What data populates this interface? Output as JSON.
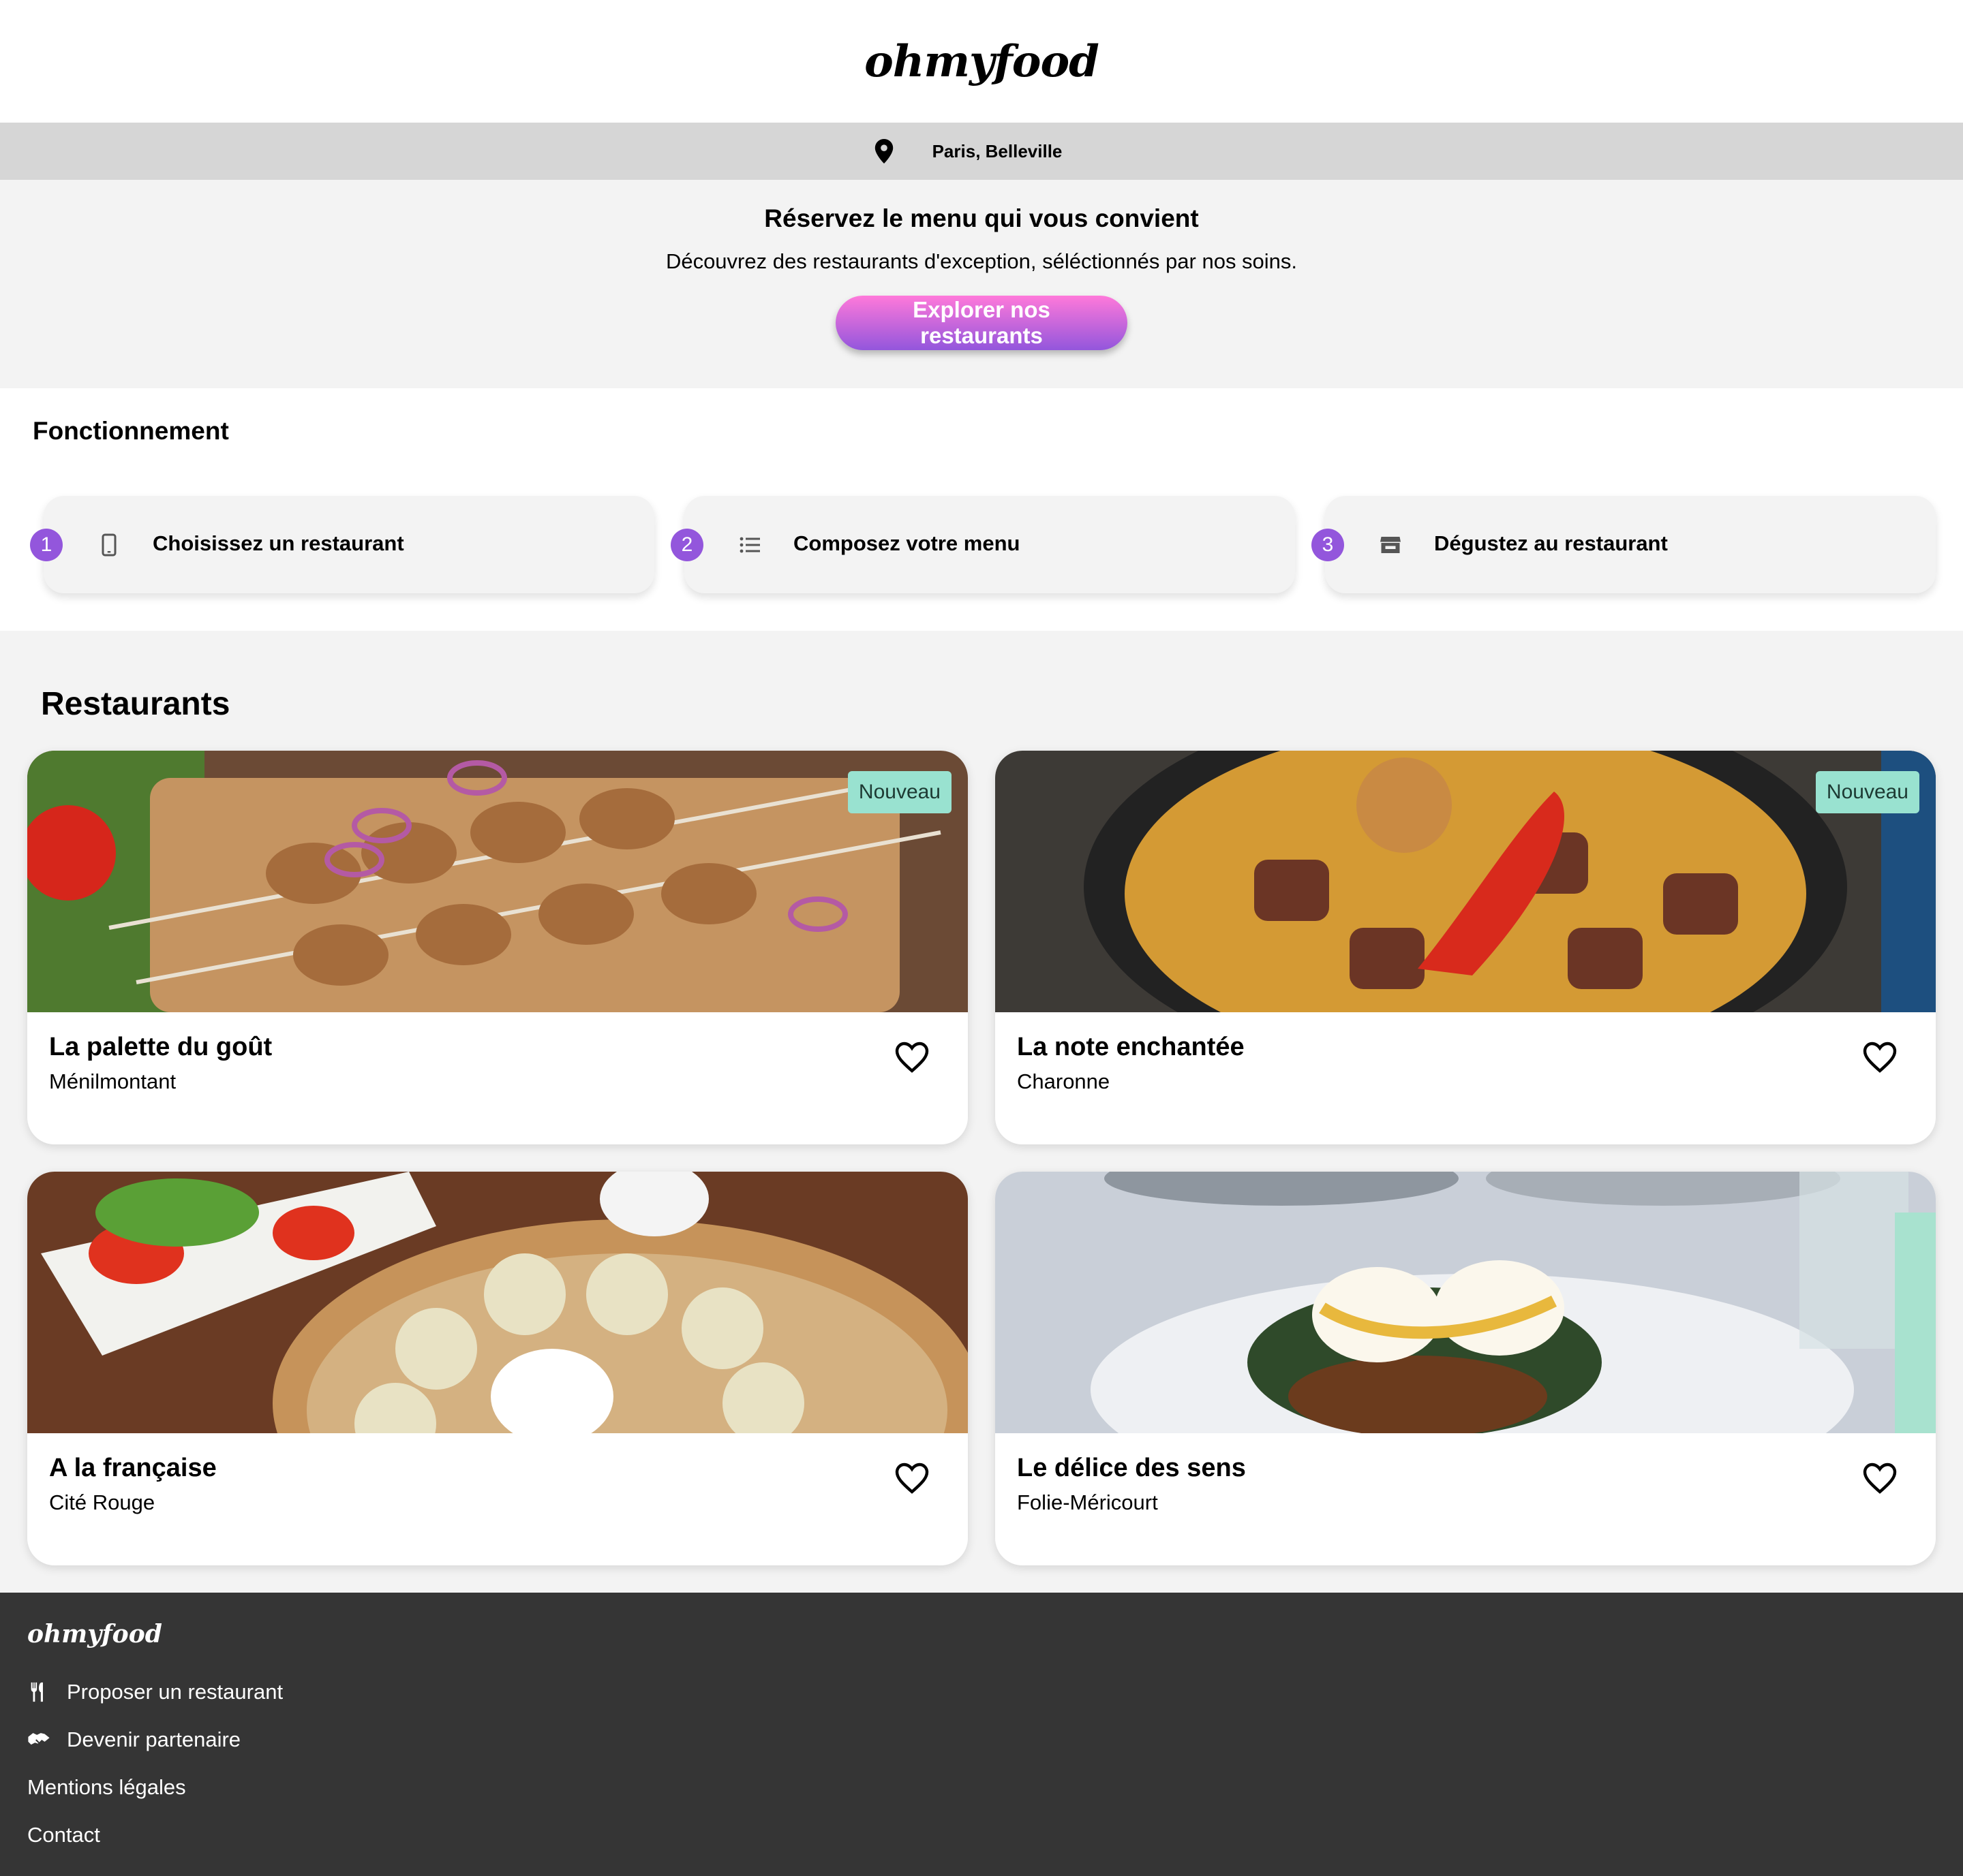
{
  "brand": {
    "logo": "ohmyfood"
  },
  "location": {
    "icon": "map-pin-icon",
    "text": "Paris, Belleville"
  },
  "hero": {
    "title": "Réservez le menu qui vous convient",
    "subtitle": "Découvrez des restaurants d'exception, séléctionnés par nos soins.",
    "cta": "Explorer nos restaurants"
  },
  "how": {
    "title": "Fonctionnement",
    "steps": [
      {
        "num": "1",
        "icon": "smartphone-icon",
        "label": "Choisissez un restaurant"
      },
      {
        "num": "2",
        "icon": "list-icon",
        "label": "Composez votre menu"
      },
      {
        "num": "3",
        "icon": "store-icon",
        "label": "Dégustez au restaurant"
      }
    ]
  },
  "restaurants": {
    "title": "Restaurants",
    "items": [
      {
        "name": "La palette du goût",
        "area": "Ménilmontant",
        "badge": "Nouveau"
      },
      {
        "name": "La note enchantée",
        "area": "Charonne",
        "badge": "Nouveau"
      },
      {
        "name": "A la française",
        "area": "Cité Rouge",
        "badge": ""
      },
      {
        "name": "Le délice des sens",
        "area": "Folie-Méricourt",
        "badge": ""
      }
    ]
  },
  "footer": {
    "logo": "ohmyfood",
    "links": [
      {
        "icon": "utensils-icon",
        "label": "Proposer un restaurant"
      },
      {
        "icon": "handshake-icon",
        "label": "Devenir partenaire"
      },
      {
        "icon": "",
        "label": "Mentions légales"
      },
      {
        "icon": "",
        "label": "Contact"
      }
    ]
  },
  "colors": {
    "accent_purple": "#9356dc",
    "accent_pink": "#ff79da",
    "badge_bg": "#99e2d0",
    "footer_bg": "#353535"
  }
}
